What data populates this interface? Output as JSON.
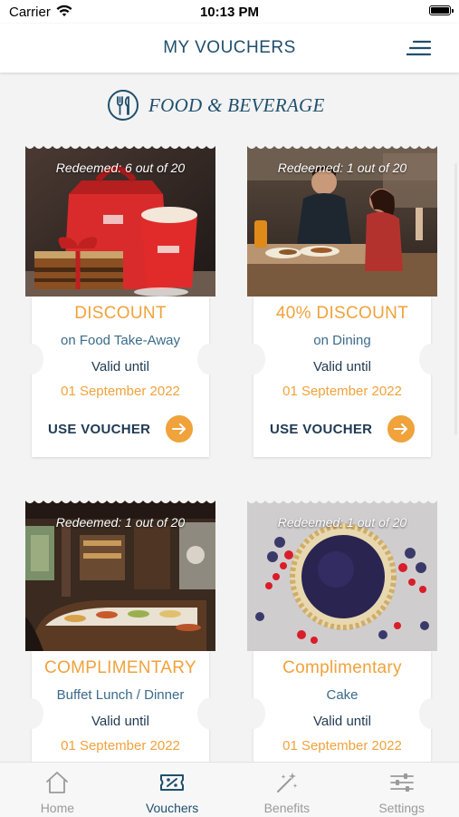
{
  "status_bar": {
    "carrier": "Carrier",
    "time": "10:13 PM"
  },
  "nav": {
    "title": "MY VOUCHERS"
  },
  "section": {
    "title": "FOOD & BEVERAGE"
  },
  "vouchers": [
    {
      "redeemed": "Redeemed: 6 out of 20",
      "title": "DISCOUNT",
      "subtitle": "on Food Take-Away",
      "valid_label": "Valid until",
      "valid_date": "01 September 2022",
      "action": "USE VOUCHER",
      "image": "takeaway-photo"
    },
    {
      "redeemed": "Redeemed: 1 out of 20",
      "title": "40% DISCOUNT",
      "subtitle": "on Dining",
      "valid_label": "Valid until",
      "valid_date": "01 September 2022",
      "action": "USE VOUCHER",
      "image": "dining-couple-photo"
    },
    {
      "redeemed": "Redeemed: 1 out of 20",
      "title": "COMPLIMENTARY",
      "subtitle": "Buffet Lunch / Dinner",
      "valid_label": "Valid until",
      "valid_date": "01 September 2022",
      "image": "buffet-photo"
    },
    {
      "redeemed": "Redeemed: 1 out of 20",
      "title": "Complimentary",
      "subtitle": "Cake",
      "valid_label": "Valid until",
      "valid_date": "01 September 2022",
      "image": "berry-tart-photo"
    }
  ],
  "tabs": [
    {
      "label": "Home",
      "icon": "home-icon",
      "active": false
    },
    {
      "label": "Vouchers",
      "icon": "voucher-icon",
      "active": true
    },
    {
      "label": "Benefits",
      "icon": "magic-wand-icon",
      "active": false
    },
    {
      "label": "Settings",
      "icon": "sliders-icon",
      "active": false
    }
  ],
  "colors": {
    "accent": "#f0a23b",
    "brand": "#1f4f6d",
    "text_dark": "#1f3a52"
  }
}
